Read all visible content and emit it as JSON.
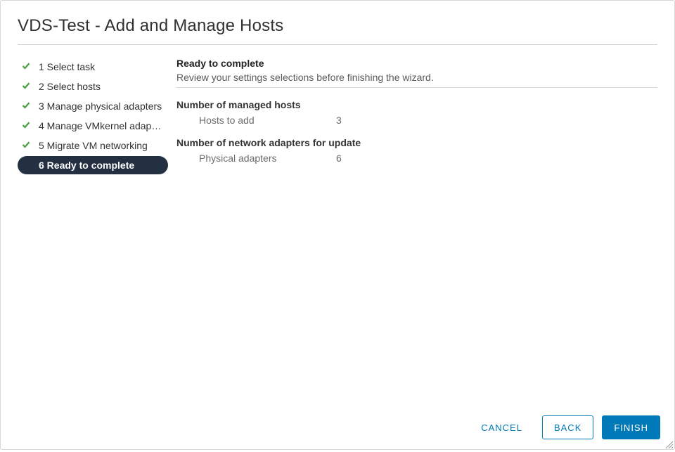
{
  "title": "VDS-Test - Add and Manage Hosts",
  "steps": [
    {
      "label": "1 Select task"
    },
    {
      "label": "2 Select hosts"
    },
    {
      "label": "3 Manage physical adapters"
    },
    {
      "label": "4 Manage VMkernel adapt…"
    },
    {
      "label": "5 Migrate VM networking"
    },
    {
      "label": "6 Ready to complete"
    }
  ],
  "content": {
    "heading": "Ready to complete",
    "description": "Review your settings selections before finishing the wizard.",
    "groups": [
      {
        "title": "Number of managed hosts",
        "rows": [
          {
            "key": "Hosts to add",
            "value": "3"
          }
        ]
      },
      {
        "title": "Number of network adapters for update",
        "rows": [
          {
            "key": "Physical adapters",
            "value": "6"
          }
        ]
      }
    ]
  },
  "footer": {
    "cancel": "CANCEL",
    "back": "BACK",
    "finish": "FINISH"
  }
}
